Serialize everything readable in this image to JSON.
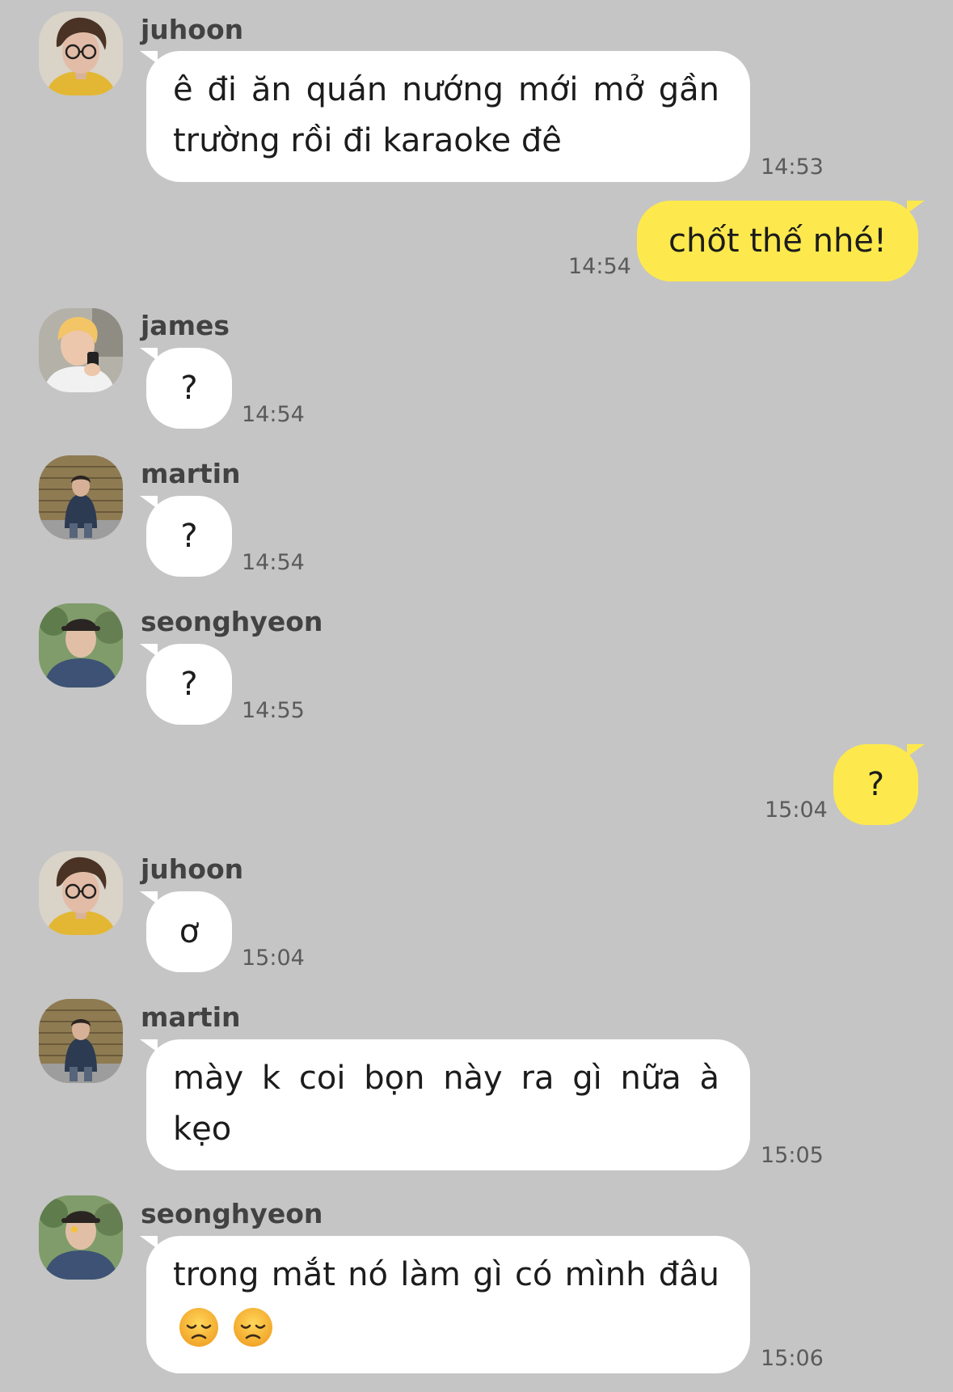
{
  "messages": [
    {
      "sender": "juhoon",
      "text": "ê đi ăn quán nướng mới mở gần trường rồi đi karaoke đê",
      "time": "14:53"
    },
    {
      "sender": "me",
      "text": "chốt thế nhé!",
      "time": "14:54"
    },
    {
      "sender": "james",
      "text": "?",
      "time": "14:54"
    },
    {
      "sender": "martin",
      "text": "?",
      "time": "14:54"
    },
    {
      "sender": "seonghyeon",
      "text": "?",
      "time": "14:55"
    },
    {
      "sender": "me",
      "text": "?",
      "time": "15:04"
    },
    {
      "sender": "juhoon",
      "text": "ơ",
      "time": "15:04"
    },
    {
      "sender": "martin",
      "text": "mày k coi bọn này ra gì nữa à kẹo",
      "time": "15:05"
    },
    {
      "sender": "seonghyeon",
      "text": "trong mắt nó làm gì có mình đâu",
      "time": "15:06",
      "emoji": "disappointed-face-emoji"
    }
  ],
  "colors": {
    "background": "#c5c5c5",
    "incoming_bubble": "#ffffff",
    "outgoing_bubble": "#fde94d",
    "timestamp": "#5a5a5a",
    "sender_name": "#424242"
  }
}
